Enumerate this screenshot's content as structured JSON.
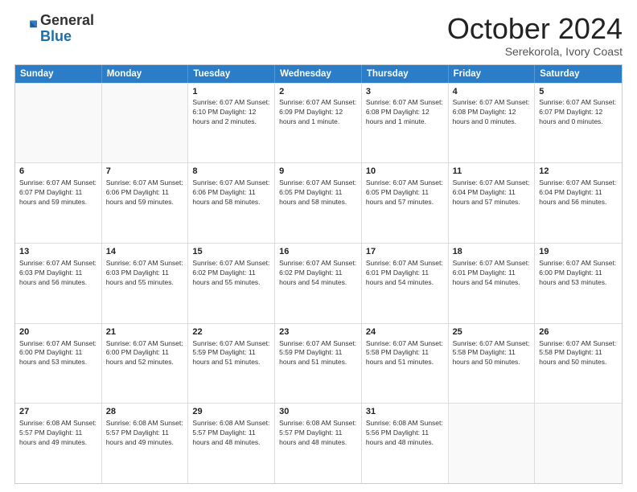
{
  "header": {
    "logo_general": "General",
    "logo_blue": "Blue",
    "month_year": "October 2024",
    "location": "Serekorola, Ivory Coast"
  },
  "calendar": {
    "days_of_week": [
      "Sunday",
      "Monday",
      "Tuesday",
      "Wednesday",
      "Thursday",
      "Friday",
      "Saturday"
    ],
    "weeks": [
      [
        {
          "day": "",
          "detail": ""
        },
        {
          "day": "",
          "detail": ""
        },
        {
          "day": "1",
          "detail": "Sunrise: 6:07 AM\nSunset: 6:10 PM\nDaylight: 12 hours\nand 2 minutes."
        },
        {
          "day": "2",
          "detail": "Sunrise: 6:07 AM\nSunset: 6:09 PM\nDaylight: 12 hours\nand 1 minute."
        },
        {
          "day": "3",
          "detail": "Sunrise: 6:07 AM\nSunset: 6:08 PM\nDaylight: 12 hours\nand 1 minute."
        },
        {
          "day": "4",
          "detail": "Sunrise: 6:07 AM\nSunset: 6:08 PM\nDaylight: 12 hours\nand 0 minutes."
        },
        {
          "day": "5",
          "detail": "Sunrise: 6:07 AM\nSunset: 6:07 PM\nDaylight: 12 hours\nand 0 minutes."
        }
      ],
      [
        {
          "day": "6",
          "detail": "Sunrise: 6:07 AM\nSunset: 6:07 PM\nDaylight: 11 hours\nand 59 minutes."
        },
        {
          "day": "7",
          "detail": "Sunrise: 6:07 AM\nSunset: 6:06 PM\nDaylight: 11 hours\nand 59 minutes."
        },
        {
          "day": "8",
          "detail": "Sunrise: 6:07 AM\nSunset: 6:06 PM\nDaylight: 11 hours\nand 58 minutes."
        },
        {
          "day": "9",
          "detail": "Sunrise: 6:07 AM\nSunset: 6:05 PM\nDaylight: 11 hours\nand 58 minutes."
        },
        {
          "day": "10",
          "detail": "Sunrise: 6:07 AM\nSunset: 6:05 PM\nDaylight: 11 hours\nand 57 minutes."
        },
        {
          "day": "11",
          "detail": "Sunrise: 6:07 AM\nSunset: 6:04 PM\nDaylight: 11 hours\nand 57 minutes."
        },
        {
          "day": "12",
          "detail": "Sunrise: 6:07 AM\nSunset: 6:04 PM\nDaylight: 11 hours\nand 56 minutes."
        }
      ],
      [
        {
          "day": "13",
          "detail": "Sunrise: 6:07 AM\nSunset: 6:03 PM\nDaylight: 11 hours\nand 56 minutes."
        },
        {
          "day": "14",
          "detail": "Sunrise: 6:07 AM\nSunset: 6:03 PM\nDaylight: 11 hours\nand 55 minutes."
        },
        {
          "day": "15",
          "detail": "Sunrise: 6:07 AM\nSunset: 6:02 PM\nDaylight: 11 hours\nand 55 minutes."
        },
        {
          "day": "16",
          "detail": "Sunrise: 6:07 AM\nSunset: 6:02 PM\nDaylight: 11 hours\nand 54 minutes."
        },
        {
          "day": "17",
          "detail": "Sunrise: 6:07 AM\nSunset: 6:01 PM\nDaylight: 11 hours\nand 54 minutes."
        },
        {
          "day": "18",
          "detail": "Sunrise: 6:07 AM\nSunset: 6:01 PM\nDaylight: 11 hours\nand 54 minutes."
        },
        {
          "day": "19",
          "detail": "Sunrise: 6:07 AM\nSunset: 6:00 PM\nDaylight: 11 hours\nand 53 minutes."
        }
      ],
      [
        {
          "day": "20",
          "detail": "Sunrise: 6:07 AM\nSunset: 6:00 PM\nDaylight: 11 hours\nand 53 minutes."
        },
        {
          "day": "21",
          "detail": "Sunrise: 6:07 AM\nSunset: 6:00 PM\nDaylight: 11 hours\nand 52 minutes."
        },
        {
          "day": "22",
          "detail": "Sunrise: 6:07 AM\nSunset: 5:59 PM\nDaylight: 11 hours\nand 51 minutes."
        },
        {
          "day": "23",
          "detail": "Sunrise: 6:07 AM\nSunset: 5:59 PM\nDaylight: 11 hours\nand 51 minutes."
        },
        {
          "day": "24",
          "detail": "Sunrise: 6:07 AM\nSunset: 5:58 PM\nDaylight: 11 hours\nand 51 minutes."
        },
        {
          "day": "25",
          "detail": "Sunrise: 6:07 AM\nSunset: 5:58 PM\nDaylight: 11 hours\nand 50 minutes."
        },
        {
          "day": "26",
          "detail": "Sunrise: 6:07 AM\nSunset: 5:58 PM\nDaylight: 11 hours\nand 50 minutes."
        }
      ],
      [
        {
          "day": "27",
          "detail": "Sunrise: 6:08 AM\nSunset: 5:57 PM\nDaylight: 11 hours\nand 49 minutes."
        },
        {
          "day": "28",
          "detail": "Sunrise: 6:08 AM\nSunset: 5:57 PM\nDaylight: 11 hours\nand 49 minutes."
        },
        {
          "day": "29",
          "detail": "Sunrise: 6:08 AM\nSunset: 5:57 PM\nDaylight: 11 hours\nand 48 minutes."
        },
        {
          "day": "30",
          "detail": "Sunrise: 6:08 AM\nSunset: 5:57 PM\nDaylight: 11 hours\nand 48 minutes."
        },
        {
          "day": "31",
          "detail": "Sunrise: 6:08 AM\nSunset: 5:56 PM\nDaylight: 11 hours\nand 48 minutes."
        },
        {
          "day": "",
          "detail": ""
        },
        {
          "day": "",
          "detail": ""
        }
      ]
    ]
  }
}
